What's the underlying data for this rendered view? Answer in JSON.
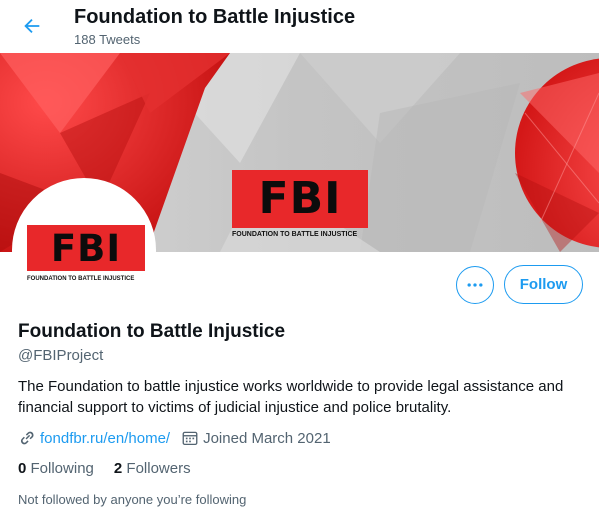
{
  "header": {
    "title": "Foundation to Battle Injustice",
    "tweet_count": "188 Tweets"
  },
  "banner": {
    "logo_text": "FBI",
    "logo_caption": "FOUNDATION TO BATTLE INJUSTICE"
  },
  "avatar": {
    "logo_text": "FBI",
    "logo_caption": "FOUNDATION TO BATTLE INJUSTICE"
  },
  "actions": {
    "follow_label": "Follow"
  },
  "profile": {
    "name": "Foundation to Battle Injustice",
    "handle": "@FBIProject",
    "bio": "The Foundation to battle injustice works worldwide to provide legal assistance and financial support to victims of judicial injustice and police brutality.",
    "website": "fondfbr.ru/en/home/",
    "joined": "Joined March 2021"
  },
  "stats": {
    "following_count": "0",
    "following_label": "Following",
    "followers_count": "2",
    "followers_label": "Followers"
  },
  "footer_note": "Not followed by anyone you’re following",
  "colors": {
    "accent": "#1d9bf0",
    "logo_red": "#e8282a",
    "muted_text": "#536471"
  },
  "icons": [
    "back-arrow-icon",
    "more-dots-icon",
    "link-icon",
    "calendar-icon"
  ]
}
